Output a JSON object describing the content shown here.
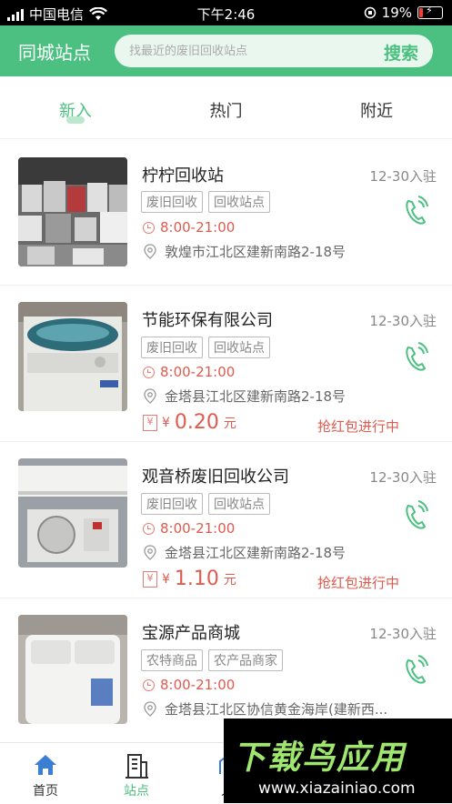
{
  "status_bar": {
    "carrier": "中国电信",
    "time": "下午2:46",
    "battery": "19%"
  },
  "header": {
    "title": "同城站点",
    "search_placeholder": "找最近的废旧回收站点",
    "search_button": "搜索"
  },
  "tabs": [
    {
      "label": "新入",
      "active": true
    },
    {
      "label": "热门",
      "active": false
    },
    {
      "label": "附近",
      "active": false
    }
  ],
  "stations": [
    {
      "name": "柠柠回收站",
      "date": "12-30入驻",
      "tags": [
        "废旧回收",
        "回收站点"
      ],
      "hours": "8:00-21:00",
      "address": "敦煌市江北区建新南路2-18号"
    },
    {
      "name": "节能环保有限公司",
      "date": "12-30入驻",
      "tags": [
        "废旧回收",
        "回收站点"
      ],
      "hours": "8:00-21:00",
      "address": "金塔县江北区建新南路2-18号",
      "price_symbol": "¥",
      "price": "0.20",
      "price_unit": "元",
      "promo": "抢红包进行中"
    },
    {
      "name": "观音桥废旧回收公司",
      "date": "12-30入驻",
      "tags": [
        "废旧回收",
        "回收站点"
      ],
      "hours": "8:00-21:00",
      "address": "金塔县江北区建新南路2-18号",
      "price_symbol": "¥",
      "price": "1.10",
      "price_unit": "元",
      "promo": "抢红包进行中"
    },
    {
      "name": "宝源产品商城",
      "date": "12-30入驻",
      "tags": [
        "农特商品",
        "农产品商家"
      ],
      "hours": "8:00-21:00",
      "address": "金塔县江北区协信黄金海岸(建新西..."
    }
  ],
  "bottom_nav": [
    {
      "label": "首页",
      "icon": "home-icon",
      "active": false
    },
    {
      "label": "站点",
      "icon": "building-icon",
      "active": true
    },
    {
      "label": "入",
      "icon": "enter-icon",
      "active": false
    }
  ],
  "watermark": {
    "title": "下载鸟应用",
    "url": "www.xiazainiao.com"
  },
  "colors": {
    "brand": "#4cc080",
    "accent_red": "#e05a4e"
  }
}
